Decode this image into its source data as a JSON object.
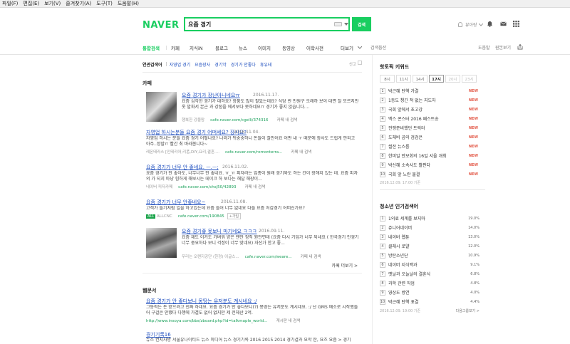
{
  "menu": [
    "파일(F)",
    "편집(E)",
    "보기(V)",
    "즐겨찾기(A)",
    "도구(T)",
    "도움말(H)"
  ],
  "header": {
    "logo": "NAVER",
    "query": "요즘 경기",
    "search_button": "검색",
    "user_name": "뷰아랑"
  },
  "tabs": [
    "통합검색",
    "카페",
    "지식iN",
    "블로그",
    "뉴스",
    "이미지",
    "동영상",
    "어학사전",
    "더보기"
  ],
  "tab_option": "검색옵션",
  "tab_right": [
    "도움말",
    "원본보기"
  ],
  "related": {
    "label": "연관검색어",
    "items": [
      "자영업 경기",
      "요즘장사",
      "경기악",
      "경기가 안좋다",
      "휴유테"
    ],
    "report": "신고"
  },
  "cafe": {
    "title": "카페",
    "items": [
      {
        "title": "요즘 경기가 장난아니네요ㅠ",
        "date": "2016.11.17.",
        "desc": "요즘 심각한 경기가 대하요? 장품도 많이 팔았는데요? 식당 반 만원구 오래까 보이 대면 잘 모르지만 옷 발화서 본근 과 강점을 에서보다 못하네요ㅠ 경기가 좋지 않습니다....",
        "source": "행복한 강물맘",
        "url": "cafe.naver.com/cgelli/374316",
        "cafe_search": "카페 내 검색"
      },
      {
        "title": "자영업 하시는분들 요즘 경기 어떠세요? 장사요?",
        "date": "2016.11.04.",
        "desc": "자영업 하시는 분들 요즘 경기 어떻나요? 나라가 뒤숭숭하니 돈들이 잘안어요 어판 내 ㅜ 때문에 장사도 드럽게 안되고 아주..정말ㅠ 빨간 최 바라봅니다~",
        "source": "레몬테라스 [인테리어,리폼,DIY,요리,결혼....",
        "url": "cafe.naver.com/remonterra...",
        "cafe_search": "카페 내 검색"
      },
      {
        "title": "요즘 경기가 너무 안 좋네요. ㅡ.ㅡ;",
        "date": "2016.11.02.",
        "desc": "요즘 경기가 안 좋아도, 너무너무 안 좋네요. ㅠ_ㅠ 피자라는 업종이 원래 경기와도 하는 건이 장해지 있는 데. 요즘 피자의 가 되지 마냥 힘하게 해보시는 데이크 하 보다는 해달 해장이...",
        "source": "네이버 피자카페",
        "url": "cafe.naver.com/chsj50/42893",
        "cafe_search": "카페 내 검색"
      },
      {
        "title": "요즘 경기가 너무 안좋네요~",
        "date": "2016.11.08.",
        "desc": "고객가 들기처럼 일을 하고있는데 요즘 들어 너무 없네요 다들 요즘 처갑경기 어떠신가요?",
        "badge": "ALL",
        "source": "ALLCNC",
        "url": "cafe.naver.com/190845",
        "btn": "+가입"
      },
      {
        "title": "요즘 경기좋 못보니 마기네요 ㅋㅋㅋ",
        "date": "2016.09.11.",
        "desc": "요즘 재도 이거도 가벼워 양은 왠만 정직 뭔만면데 (요즘 다시 기업가 너무 되네요 ( 한국경기 인경기 너무 중요하다 보니 걱정이 너무 맞네요) 자선가 한고 좋...",
        "source": "우리는 오렌지공단 (한정) 이글스...",
        "url": "cafe.naver.com/weare...",
        "cafe_search": "카페 내 검색"
      }
    ],
    "more": "카페 더보기 >"
  },
  "web": {
    "title": "웹문서",
    "items": [
      {
        "title": "요즘 경기가 안 좋다보니 몽땅는 유저분도 계시네요 :/",
        "desc": "그동적는 돈 받으려고 진짜 하네요. 요즘 경기가 안 좋다보니(?) 몽땅는 유저분도 계시네요. :/ 난 GMS 메소로 시작했들어 구걸은 안했다 다행에 가결도 없어 없지만 제 전체산 2억.",
        "url": "http://www.insoya.com/bbs/zboard.php?id=talkmaple_world...",
        "meta_tail": "게시판 내 검색"
      },
      {
        "title": "경기기록16",
        "desc": "뉴스 컨지사방 서울유나이티드 뉴스 미디어 뉴스 경기기록 2016 2015 2014 경기결과 요약 한, 요즈 요즘 > 경기"
      }
    ]
  },
  "hot": {
    "title": "핫토픽 키워드",
    "hours": [
      "8시",
      "11시",
      "14시",
      "17시",
      "20시",
      "23시"
    ],
    "items": [
      {
        "rank": "1",
        "kw": "박근혜 탄핵 가결",
        "new": "NEW"
      },
      {
        "rank": "2",
        "kw": "1등도 챙긴 적 없는 지도자",
        "new": "NEW"
      },
      {
        "rank": "3",
        "kw": "국회 앞에서 초고강",
        "new": "NEW"
      },
      {
        "rank": "4",
        "kw": "멕스 콘스터 2016 페스트송",
        "new": "NEW"
      },
      {
        "rank": "5",
        "kw": "전쟁준비했던 트럭터",
        "new": "NEW"
      },
      {
        "rank": "6",
        "kw": "도체비 곰의 검검은",
        "new": "NEW"
      },
      {
        "rank": "7",
        "kw": "썰전 뉴스룸",
        "new": "NEW"
      },
      {
        "rank": "8",
        "kw": "한미일 안보회의 16일 서울 개최",
        "new": "NEW"
      },
      {
        "rank": "9",
        "kw": "박신혜 소속사도 활판다",
        "new": "NEW"
      },
      {
        "rank": "10",
        "kw": "국회 앞 노란 물결",
        "new": "NEW"
      }
    ],
    "foot": "2016.12.09. 17:00 기준"
  },
  "youth": {
    "title": "청소년 인기검색어",
    "items": [
      {
        "rank": "1",
        "kw": "1의료 세계를 보지마",
        "pct": "19.0%"
      },
      {
        "rank": "2",
        "kw": "쥬니어네이버",
        "pct": "14.0%"
      },
      {
        "rank": "3",
        "kw": "네이버 웹툰",
        "pct": "13.0%"
      },
      {
        "rank": "4",
        "kw": "클래시 로얄",
        "pct": "12.0%"
      },
      {
        "rank": "5",
        "kw": "방탄소년단",
        "pct": "10.9%"
      },
      {
        "rank": "6",
        "kw": "네이버 지식백과",
        "pct": "9.1%"
      },
      {
        "rank": "7",
        "kw": "옛날과 오늘날의 결혼식",
        "pct": "6.8%"
      },
      {
        "rank": "8",
        "kw": "과학 관련 직업",
        "pct": "4.8%"
      },
      {
        "rank": "9",
        "kw": "영상도 방연",
        "pct": "4.0%"
      },
      {
        "rank": "10",
        "kw": "박근혜 탄핵 표결",
        "pct": "4.4%"
      }
    ],
    "foot": "2016.12.09. 19:00 기준",
    "foot_right": "다음그룹보기 >"
  }
}
